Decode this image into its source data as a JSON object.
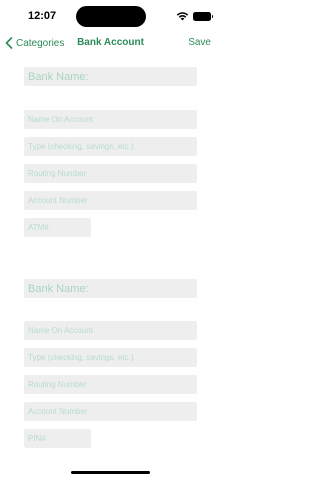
{
  "status_bar": {
    "time": "12:07"
  },
  "nav": {
    "back_label": "Categories",
    "title": "Bank Account",
    "save_label": "Save"
  },
  "account_1": {
    "bank_name": "Bank Name:",
    "name_on_account": "Name On Account",
    "type": "Type (checking, savings, etc.)",
    "routing_number": "Routing Number",
    "account_number": "Account Number",
    "code": "ATM#"
  },
  "account_2": {
    "bank_name": "Bank Name:",
    "name_on_account": "Name On Account",
    "type": "Type (checking, savings, etc.)",
    "routing_number": "Routing Number",
    "account_number": "Account Number",
    "code": "PIN#"
  }
}
